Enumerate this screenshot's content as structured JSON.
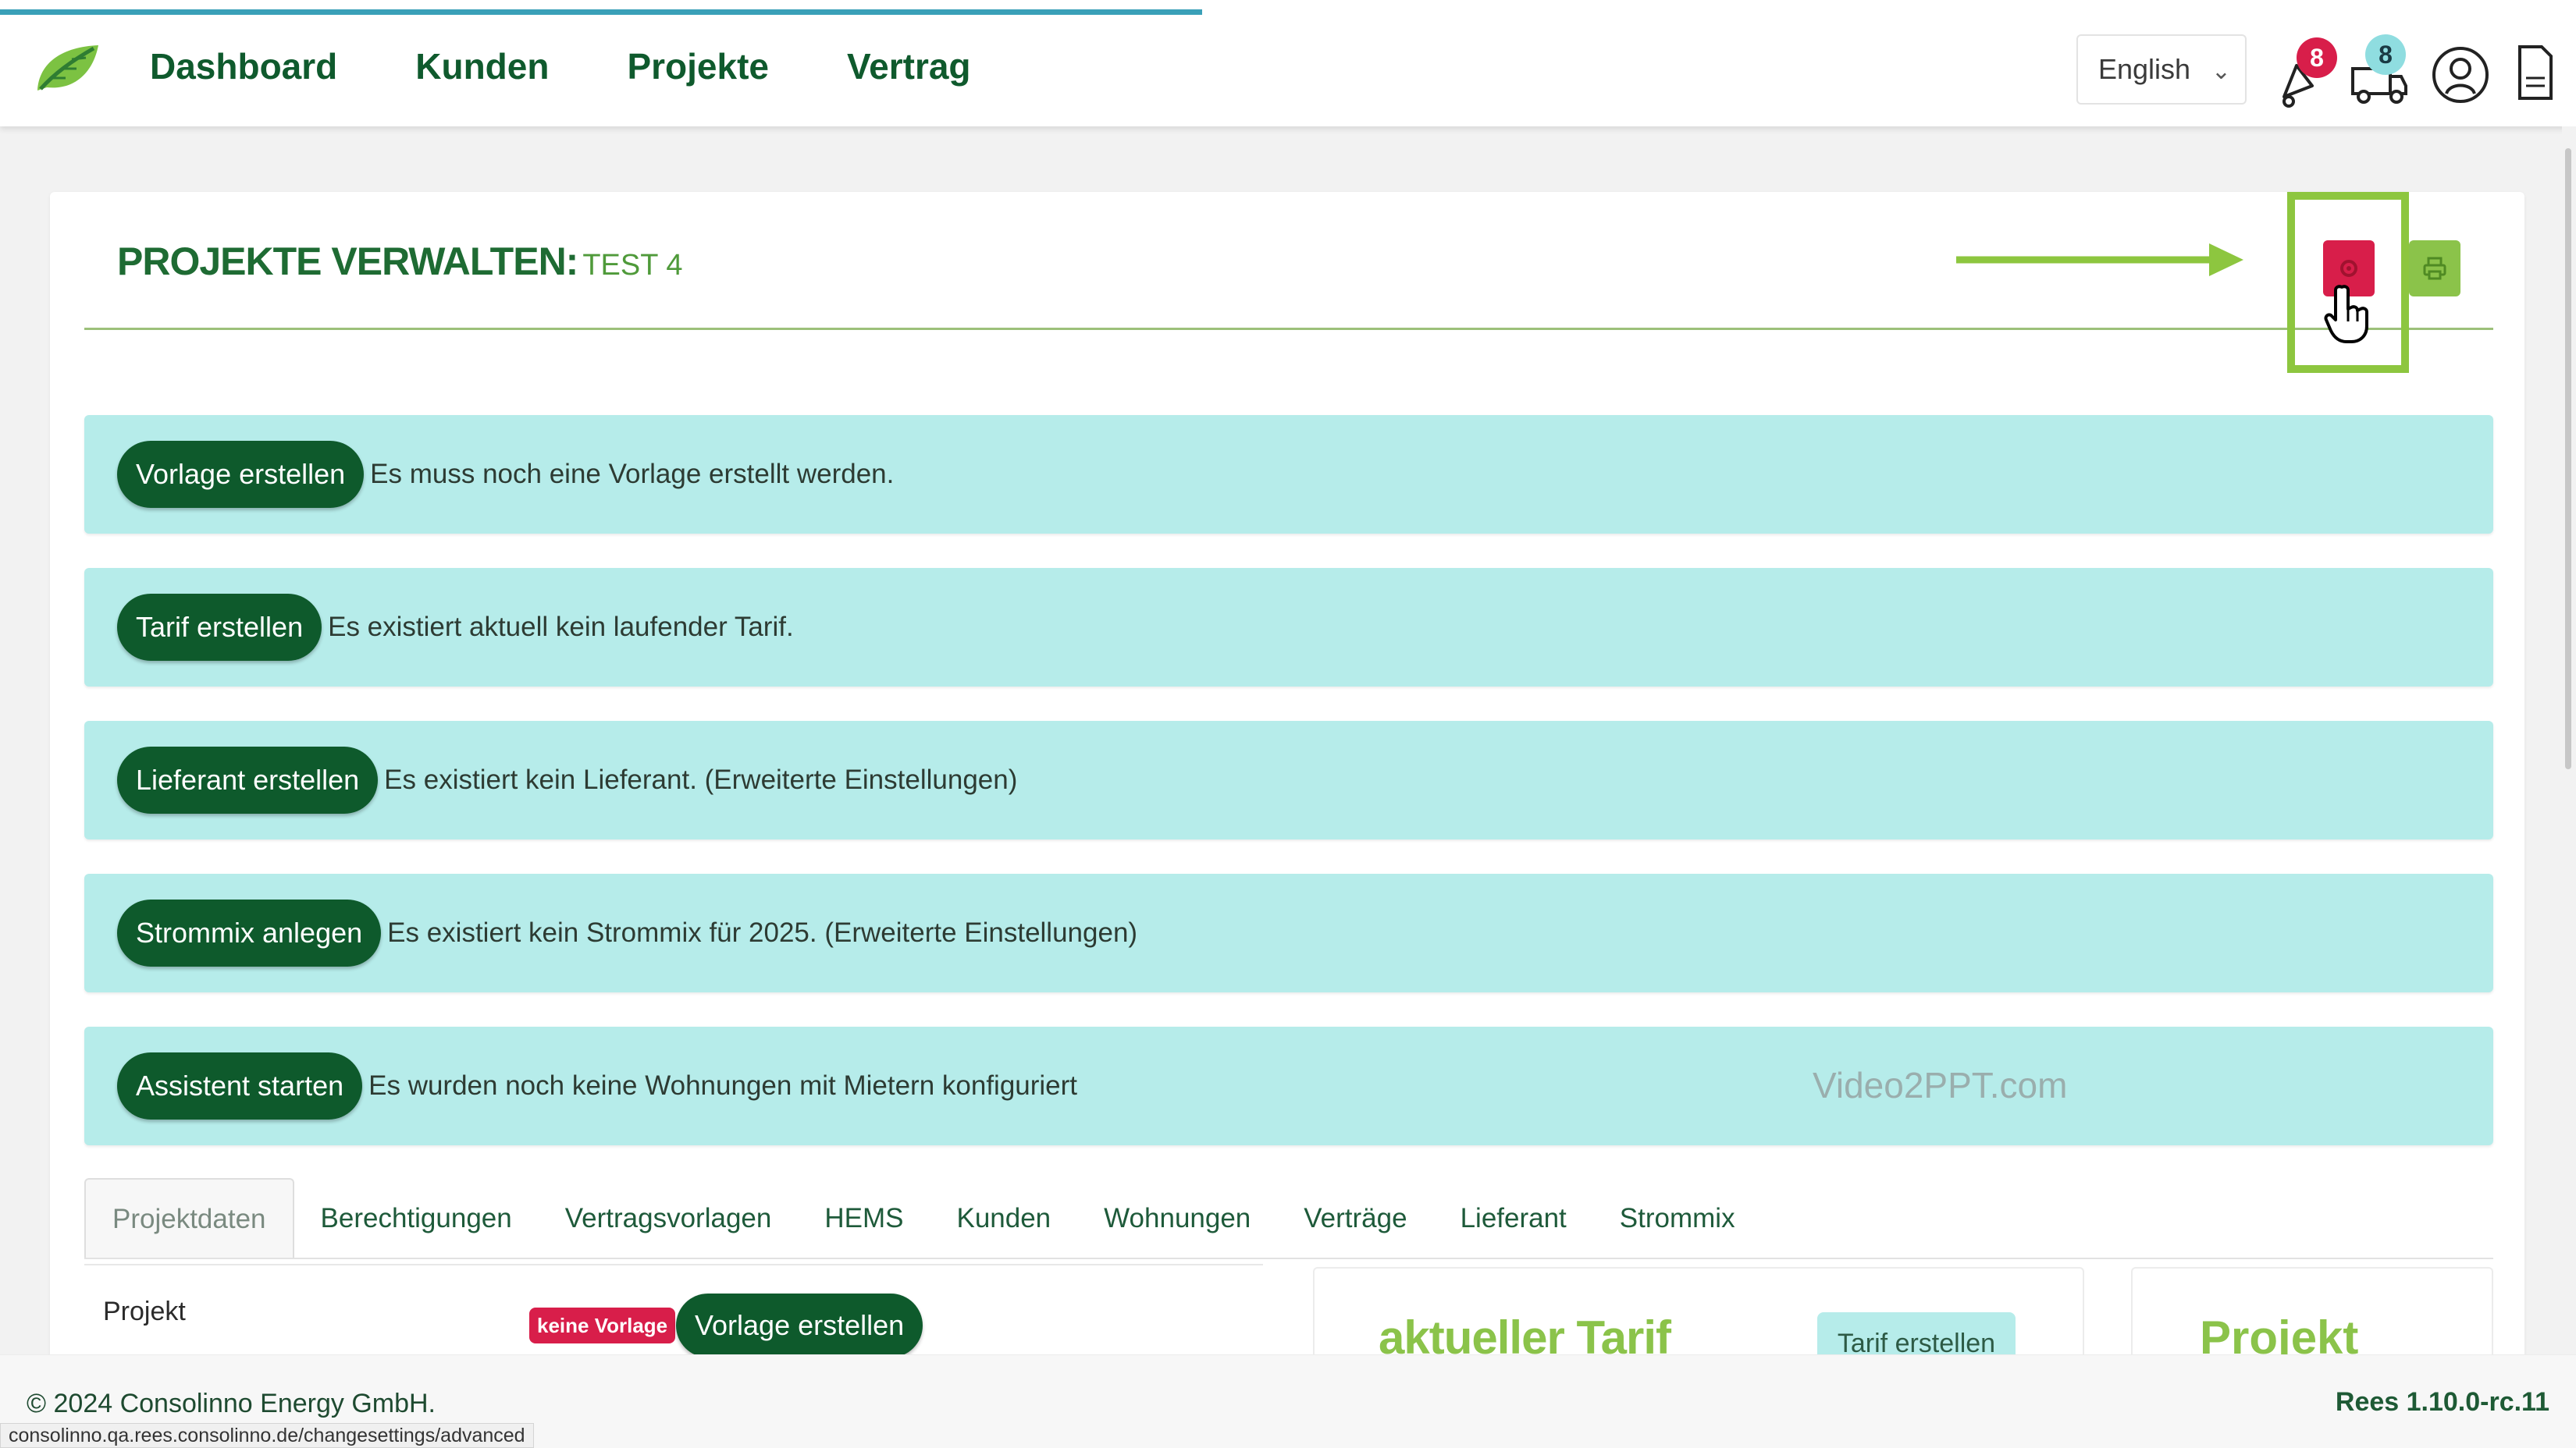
{
  "header": {
    "nav": [
      "Dashboard",
      "Kunden",
      "Projekte",
      "Vertrag"
    ],
    "language": {
      "selected": "English"
    },
    "notifications_count": "8",
    "messages_count": "8"
  },
  "page": {
    "title": "PROJEKTE VERWALTEN:",
    "subtitle": "TEST 4"
  },
  "banners": [
    {
      "button": "Vorlage erstellen",
      "text": "Es muss noch eine Vorlage erstellt werden."
    },
    {
      "button": "Tarif erstellen",
      "text": "Es existiert aktuell kein laufender Tarif."
    },
    {
      "button": "Lieferant erstellen",
      "text": "Es existiert kein Lieferant. (Erweiterte Einstellungen)"
    },
    {
      "button": "Strommix anlegen",
      "text": "Es existiert kein Strommix für 2025. (Erweiterte Einstellungen)"
    },
    {
      "button": "Assistent starten",
      "text": "Es wurden noch keine Wohnungen mit Mietern konfiguriert"
    }
  ],
  "watermark": "Video2PPT.com",
  "tabs": [
    "Projektdaten",
    "Berechtigungen",
    "Vertragsvorlagen",
    "HEMS",
    "Kunden",
    "Wohnungen",
    "Verträge",
    "Lieferant",
    "Strommix"
  ],
  "project_section": {
    "field_label": "Projekt",
    "badge": "keine Vorlage",
    "button": "Vorlage erstellen"
  },
  "tariff_section": {
    "heading": "aktueller Tarif",
    "button": "Tarif erstellen"
  },
  "project_card": {
    "heading": "Projekt"
  },
  "footer": {
    "copyright": "© 2024 Consolinno Energy GmbH.",
    "version": "Rees 1.10.0-rc.11",
    "status_url": "consolinno.qa.rees.consolinno.de/changesettings/advanced"
  },
  "colors": {
    "brand_dark_green": "#0e5a2c",
    "accent_green": "#8bc34a",
    "banner_teal": "#b6ecea",
    "danger_red": "#d81e4a",
    "highlight_box": "#8dc63f"
  },
  "icons": [
    "leaf-logo-icon",
    "bell-icon",
    "delivery-truck-icon",
    "user-circle-icon",
    "document-icon",
    "gear-icon",
    "printer-icon",
    "pointer-hand-icon",
    "arrow-right-icon"
  ]
}
